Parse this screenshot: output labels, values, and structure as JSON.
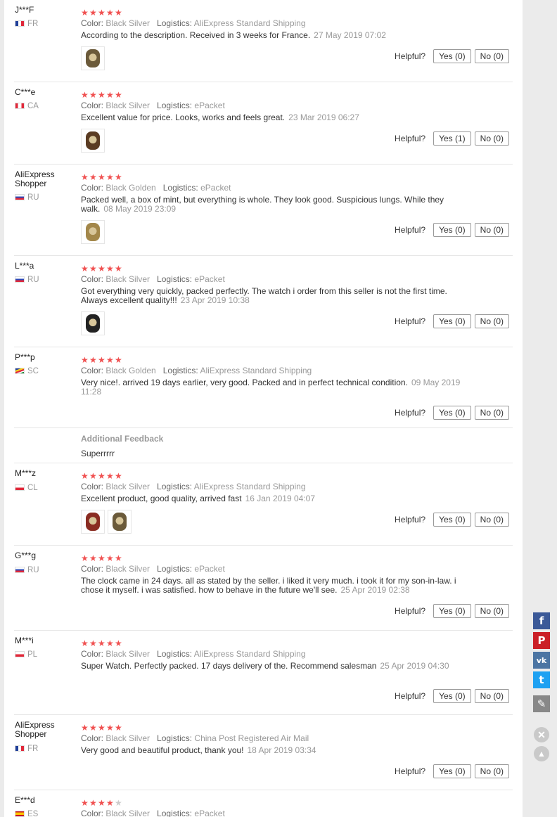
{
  "helpful_label": "Helpful?",
  "additional_feedback_title": "Additional Feedback",
  "reviews": [
    {
      "user": "J***F",
      "country": "FR",
      "rating": 5,
      "color_label": "Color:",
      "color": "Black Silver",
      "logistics_label": "Logistics:",
      "logistics": "AliExpress Standard Shipping",
      "text": "According to the description. Received in 3 weeks for France.",
      "date": "27 May 2019 07:02",
      "photos": 1,
      "yes": "Yes (0)",
      "no": "No (0)"
    },
    {
      "user": "C***e",
      "country": "CA",
      "rating": 5,
      "color_label": "Color:",
      "color": "Black Silver",
      "logistics_label": "Logistics:",
      "logistics": "ePacket",
      "text": "Excellent value for price. Looks, works and feels great.",
      "date": "23 Mar 2019 06:27",
      "photos": 1,
      "yes": "Yes (1)",
      "no": "No (0)"
    },
    {
      "user": "AliExpress Shopper",
      "country": "RU",
      "rating": 5,
      "color_label": "Color:",
      "color": "Black Golden",
      "logistics_label": "Logistics:",
      "logistics": "ePacket",
      "text": "Packed well, a box of mint, but everything is whole. They look good. Suspicious lungs. While they walk.",
      "date": "08 May 2019 23:09",
      "photos": 1,
      "yes": "Yes (0)",
      "no": "No (0)"
    },
    {
      "user": "L***a",
      "country": "RU",
      "rating": 5,
      "color_label": "Color:",
      "color": "Black Silver",
      "logistics_label": "Logistics:",
      "logistics": "ePacket",
      "text": "Got everything very quickly, packed perfectly. The watch i order from this seller is not the first time. Always excellent quality!!!",
      "date": "23 Apr 2019 10:38",
      "photos": 1,
      "yes": "Yes (0)",
      "no": "No (0)"
    },
    {
      "user": "P***p",
      "country": "SC",
      "rating": 5,
      "color_label": "Color:",
      "color": "Black Golden",
      "logistics_label": "Logistics:",
      "logistics": "AliExpress Standard Shipping",
      "text": "Very nice!. arrived 19 days earlier, very good. Packed and in perfect technical condition.",
      "date": "09 May 2019 11:28",
      "photos": 0,
      "yes": "Yes (0)",
      "no": "No (0)",
      "additional": "Superrrrr"
    },
    {
      "user": "M***z",
      "country": "CL",
      "rating": 5,
      "color_label": "Color:",
      "color": "Black Silver",
      "logistics_label": "Logistics:",
      "logistics": "AliExpress Standard Shipping",
      "text": "Excellent product, good quality, arrived fast",
      "date": "16 Jan 2019 04:07",
      "photos": 2,
      "yes": "Yes (0)",
      "no": "No (0)"
    },
    {
      "user": "G***g",
      "country": "RU",
      "rating": 5,
      "color_label": "Color:",
      "color": "Black Silver",
      "logistics_label": "Logistics:",
      "logistics": "ePacket",
      "text": "The clock came in 24 days. all as stated by the seller. i liked it very much. i took it for my son-in-law. i chose it myself. i was satisfied. how to behave in the future we'll see.",
      "date": "25 Apr 2019 02:38",
      "photos": 0,
      "yes": "Yes (0)",
      "no": "No (0)"
    },
    {
      "user": "M***i",
      "country": "PL",
      "rating": 5,
      "color_label": "Color:",
      "color": "Black Silver",
      "logistics_label": "Logistics:",
      "logistics": "AliExpress Standard Shipping",
      "text": "Super Watch. Perfectly packed. 17 days delivery of the. Recommend salesman",
      "date": "25 Apr 2019 04:30",
      "photos": 0,
      "yes": "Yes (0)",
      "no": "No (0)"
    },
    {
      "user": "AliExpress Shopper",
      "country": "FR",
      "rating": 5,
      "color_label": "Color:",
      "color": "Black Silver",
      "logistics_label": "Logistics:",
      "logistics": "China Post Registered Air Mail",
      "text": "Very good and beautiful product, thank you!",
      "date": "18 Apr 2019 03:34",
      "photos": 0,
      "yes": "Yes (0)",
      "no": "No (0)"
    },
    {
      "user": "E***d",
      "country": "ES",
      "rating": 4,
      "color_label": "Color:",
      "color": "Black Silver",
      "logistics_label": "Logistics:",
      "logistics": "ePacket",
      "text": "",
      "date": "",
      "photos": 0,
      "yes": "",
      "no": ""
    }
  ],
  "share": [
    {
      "name": "facebook-icon",
      "glyph": "f",
      "color": "#3b5998"
    },
    {
      "name": "pinterest-icon",
      "glyph": "P",
      "color": "#cb2027"
    },
    {
      "name": "vk-icon",
      "glyph": "vk",
      "color": "#4c75a3"
    },
    {
      "name": "twitter-icon",
      "glyph": "t",
      "color": "#1da1f2"
    },
    {
      "name": "edit-icon",
      "glyph": "✎",
      "color": "#888888"
    }
  ]
}
